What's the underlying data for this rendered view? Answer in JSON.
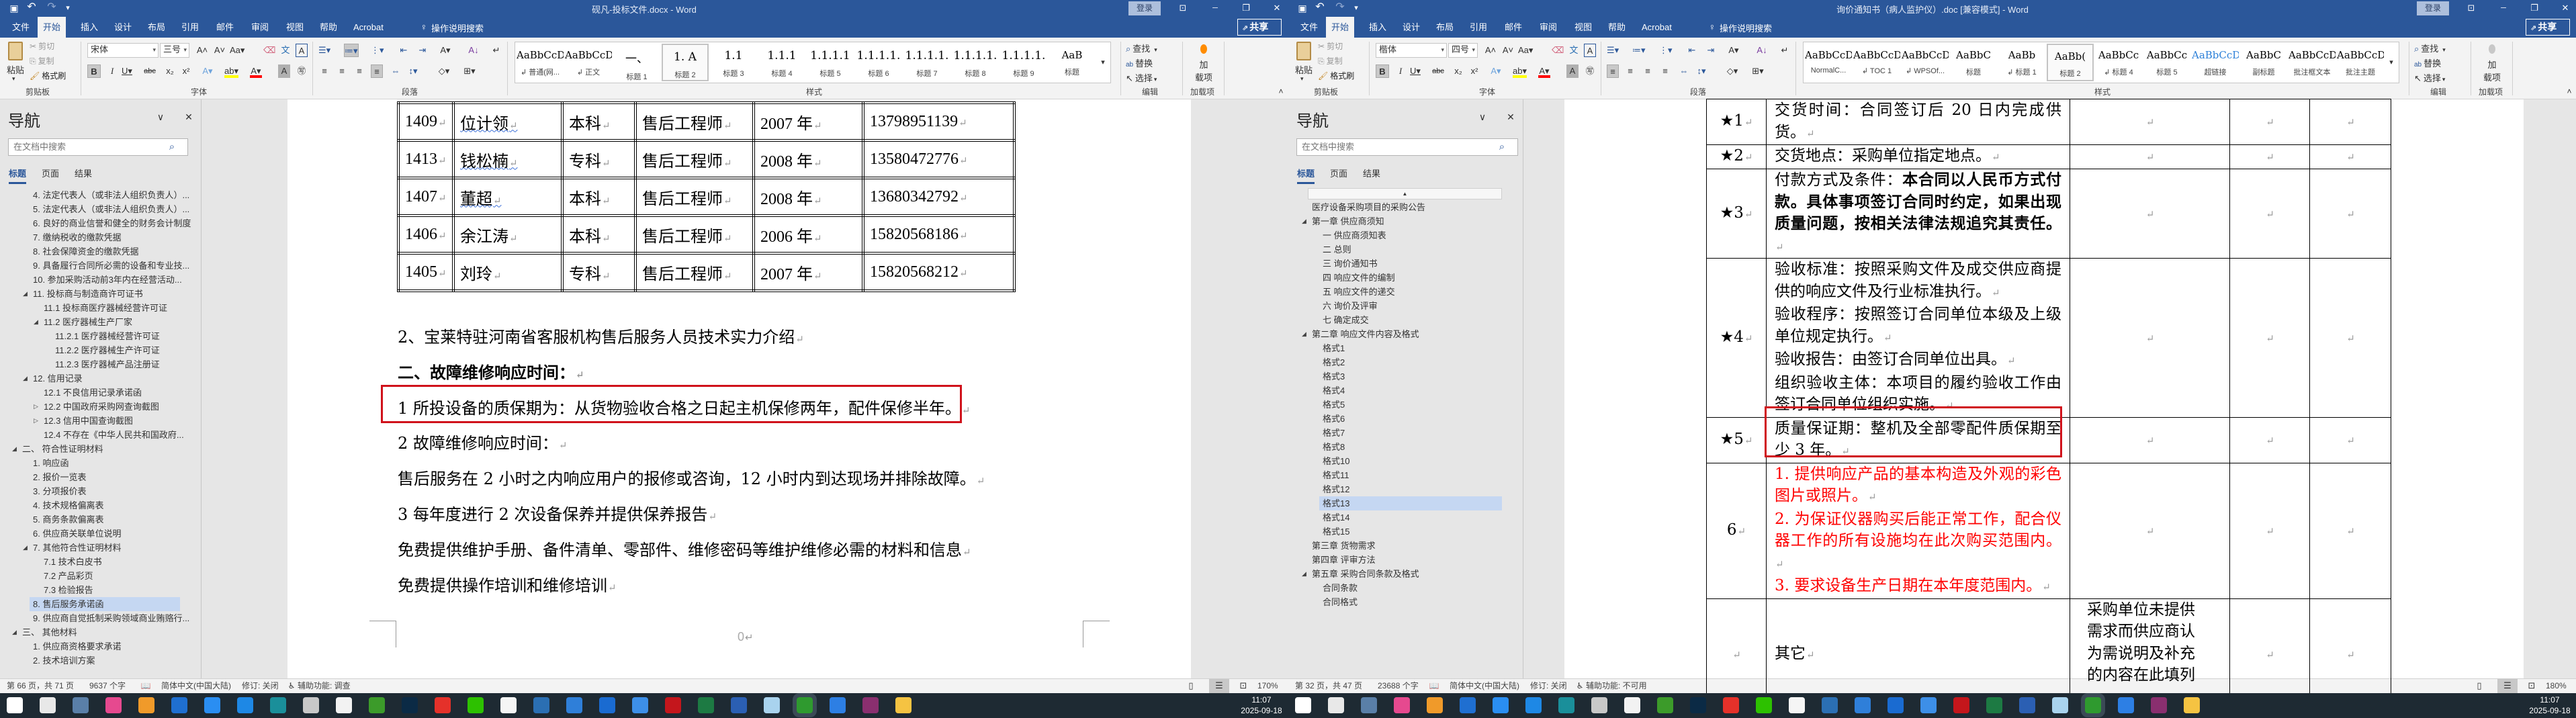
{
  "windows": [
    {
      "title": "砚凡-投标文件.docx - Word",
      "sign_in": "登录",
      "share": "共享",
      "tabs": [
        "文件",
        "开始",
        "插入",
        "设计",
        "布局",
        "引用",
        "邮件",
        "审阅",
        "视图",
        "帮助",
        "Acrobat"
      ],
      "active_tab": 1,
      "tell_me": "操作说明搜索",
      "ribbon": {
        "clipboard": {
          "paste": "粘贴",
          "cut": "剪切",
          "copy": "复制",
          "format_painter": "格式刷",
          "label": "剪贴板"
        },
        "font": {
          "name": "宋体",
          "size": "三号",
          "label": "字体"
        },
        "paragraph": {
          "label": "段落"
        },
        "styles": {
          "label": "样式",
          "selected": 3,
          "items": [
            {
              "preview": "AaBbCcDc",
              "name": "↲ 普通(网..."
            },
            {
              "preview": "AaBbCcDi",
              "name": "↲ 正文"
            },
            {
              "preview": "一、",
              "name": "标题 1"
            },
            {
              "preview": "1.  A",
              "name": "标题 2"
            },
            {
              "preview": "1.1",
              "name": "标题 3"
            },
            {
              "preview": "1.1.1",
              "name": "标题 4"
            },
            {
              "preview": "1.1.1.1",
              "name": "标题 5"
            },
            {
              "preview": "1.1.1.1.",
              "name": "标题 6"
            },
            {
              "preview": "1.1.1.1.",
              "name": "标题 7"
            },
            {
              "preview": "1.1.1.1.",
              "name": "标题 8"
            },
            {
              "preview": "1.1.1.1.",
              "name": "标题 9"
            },
            {
              "preview": "AaB",
              "name": "标题"
            }
          ]
        },
        "editing": {
          "find": "查找",
          "replace": "替换",
          "select": "选择",
          "label": "编辑"
        },
        "addins": {
          "button_line1": "加",
          "button_line2": "载项",
          "label": "加载项"
        }
      },
      "nav": {
        "title": "导航",
        "search_placeholder": "在文档中搜索",
        "tabs": [
          "标题",
          "页面",
          "结果"
        ],
        "items": [
          {
            "text": "4. 法定代表人（或非法人组织负责人）...",
            "level": 1,
            "toggle": "none"
          },
          {
            "text": "5. 法定代表人（或非法人组织负责人）...",
            "level": 1,
            "toggle": "none"
          },
          {
            "text": "6. 良好的商业信誉和健全的财务会计制度",
            "level": 1,
            "toggle": "none"
          },
          {
            "text": "7. 缴纳税收的缴款凭据",
            "level": 1,
            "toggle": "none"
          },
          {
            "text": "8. 社会保障资金的缴款凭据",
            "level": 1,
            "toggle": "none"
          },
          {
            "text": "9. 具备履行合同所必需的设备和专业技...",
            "level": 1,
            "toggle": "none"
          },
          {
            "text": "10. 参加采购活动前3年内在经营活动...",
            "level": 1,
            "toggle": "none"
          },
          {
            "text": "11. 投标商与制造商许可证书",
            "level": 1,
            "toggle": "expanded"
          },
          {
            "text": "11.1 投标商医疗器械经营许可证",
            "level": 2,
            "toggle": "none"
          },
          {
            "text": "11.2 医疗器械生产厂家",
            "level": 2,
            "toggle": "expanded"
          },
          {
            "text": "11.2.1 医疗器械经营许可证",
            "level": 3,
            "toggle": "none"
          },
          {
            "text": "11.2.2 医疗器械生产许可证",
            "level": 3,
            "toggle": "none"
          },
          {
            "text": "11.2.3 医疗器械产品注册证",
            "level": 3,
            "toggle": "none"
          },
          {
            "text": "12. 信用记录",
            "level": 1,
            "toggle": "expanded"
          },
          {
            "text": "12.1 不良信用记录承诺函",
            "level": 2,
            "toggle": "none"
          },
          {
            "text": "12.2 中国政府采购网查询截图",
            "level": 2,
            "toggle": "collapsed"
          },
          {
            "text": "12.3 信用中国查询截图",
            "level": 2,
            "toggle": "collapsed"
          },
          {
            "text": "12.4 不存在《中华人民共和国政府...",
            "level": 2,
            "toggle": "none"
          },
          {
            "text": "二、  符合性证明材料",
            "level": 0,
            "toggle": "expanded"
          },
          {
            "text": "1. 响应函",
            "level": 1,
            "toggle": "none"
          },
          {
            "text": "2. 报价一览表",
            "level": 1,
            "toggle": "none"
          },
          {
            "text": "3. 分项报价表",
            "level": 1,
            "toggle": "none"
          },
          {
            "text": "4. 技术规格偏离表",
            "level": 1,
            "toggle": "none"
          },
          {
            "text": "5. 商务条款偏离表",
            "level": 1,
            "toggle": "none"
          },
          {
            "text": "6. 供应商关联单位说明",
            "level": 1,
            "toggle": "none"
          },
          {
            "text": "7. 其他符合性证明材料",
            "level": 1,
            "toggle": "expanded"
          },
          {
            "text": "7.1 技术白皮书",
            "level": 2,
            "toggle": "none"
          },
          {
            "text": "7.2 产品彩页",
            "level": 2,
            "toggle": "none"
          },
          {
            "text": "7.3 检验报告",
            "level": 2,
            "toggle": "none"
          },
          {
            "text": "8. 售后服务承诺函",
            "level": 1,
            "toggle": "none",
            "selected": true
          },
          {
            "text": "9. 供应商自觉抵制采购领域商业贿赂行...",
            "level": 1,
            "toggle": "none"
          },
          {
            "text": "三、  其他材料",
            "level": 0,
            "toggle": "expanded"
          },
          {
            "text": "1. 供应商资格要求承诺",
            "level": 1,
            "toggle": "none"
          },
          {
            "text": "2. 技术培训方案",
            "level": 1,
            "toggle": "none"
          }
        ]
      },
      "status": {
        "page": "第 66 页，共 71 页",
        "words": "9637 个字",
        "language": "简体中文(中国大陆)",
        "track_changes": "修订: 关闭",
        "accessibility": "辅助功能: 调查",
        "zoom": "170%"
      }
    },
    {
      "title": "询价通知书（病人监护仪）.doc [兼容模式] - Word",
      "sign_in": "登录",
      "share": "共享",
      "tabs": [
        "文件",
        "开始",
        "插入",
        "设计",
        "布局",
        "引用",
        "邮件",
        "审阅",
        "视图",
        "帮助",
        "Acrobat"
      ],
      "active_tab": 1,
      "tell_me": "操作说明搜索",
      "ribbon": {
        "clipboard": {
          "paste": "粘贴",
          "cut": "剪切",
          "copy": "复制",
          "format_painter": "格式刷",
          "label": "剪贴板"
        },
        "font": {
          "name": "楷体",
          "size": "四号",
          "label": "字体"
        },
        "paragraph": {
          "label": "段落"
        },
        "styles": {
          "label": "样式",
          "selected": 5,
          "items": [
            {
              "preview": "AaBbCcDd",
              "name": "NormalC..."
            },
            {
              "preview": "AaBbCcDd",
              "name": "↲ TOC 1"
            },
            {
              "preview": "AaBbCcDdE",
              "name": "↲ WPSOf..."
            },
            {
              "preview": "AaBbC",
              "name": "标题"
            },
            {
              "preview": "AaBb",
              "name": "↲ 标题 1"
            },
            {
              "preview": "AaBb(",
              "name": "标题 2"
            },
            {
              "preview": "AaBbCc",
              "name": "↲ 标题 4"
            },
            {
              "preview": "AaBbCc",
              "name": "标题 5"
            },
            {
              "preview": "AaBbCcDd",
              "name": "超链接"
            },
            {
              "preview": "AaBbC",
              "name": "副标题"
            },
            {
              "preview": "AaBbCcDdE",
              "name": "批注框文本"
            },
            {
              "preview": "AaBbCcDd",
              "name": "批注主题"
            }
          ]
        },
        "editing": {
          "find": "查找",
          "replace": "替换",
          "select": "选择",
          "label": "编辑"
        },
        "addins": {
          "button_line1": "加",
          "button_line2": "载项",
          "label": "加载项"
        }
      },
      "nav": {
        "title": "导航",
        "search_placeholder": "在文档中搜索",
        "tabs": [
          "标题",
          "页面",
          "结果"
        ],
        "items": [
          {
            "text": "医疗设备采购项目的采购公告",
            "level": 0,
            "toggle": "none"
          },
          {
            "text": "第一章 供应商须知",
            "level": 0,
            "toggle": "expanded"
          },
          {
            "text": "一 供应商须知表",
            "level": 1,
            "toggle": "none"
          },
          {
            "text": "二 总则",
            "level": 1,
            "toggle": "none"
          },
          {
            "text": "三 询价通知书",
            "level": 1,
            "toggle": "none"
          },
          {
            "text": "四 响应文件的编制",
            "level": 1,
            "toggle": "none"
          },
          {
            "text": "五 响应文件的递交",
            "level": 1,
            "toggle": "none"
          },
          {
            "text": "六 询价及评审",
            "level": 1,
            "toggle": "none"
          },
          {
            "text": "七 确定成交",
            "level": 1,
            "toggle": "none"
          },
          {
            "text": "第二章 响应文件内容及格式",
            "level": 0,
            "toggle": "expanded"
          },
          {
            "text": "格式1",
            "level": 1,
            "toggle": "none"
          },
          {
            "text": "格式2",
            "level": 1,
            "toggle": "none"
          },
          {
            "text": "格式3",
            "level": 1,
            "toggle": "none"
          },
          {
            "text": "格式4",
            "level": 1,
            "toggle": "none"
          },
          {
            "text": "格式5",
            "level": 1,
            "toggle": "none"
          },
          {
            "text": "格式6",
            "level": 1,
            "toggle": "none"
          },
          {
            "text": "格式7",
            "level": 1,
            "toggle": "none"
          },
          {
            "text": "格式8",
            "level": 1,
            "toggle": "none"
          },
          {
            "text": "格式10",
            "level": 1,
            "toggle": "none"
          },
          {
            "text": "格式11",
            "level": 1,
            "toggle": "none"
          },
          {
            "text": "格式12",
            "level": 1,
            "toggle": "none"
          },
          {
            "text": "格式13",
            "level": 1,
            "toggle": "none",
            "selected": true
          },
          {
            "text": "格式14",
            "level": 1,
            "toggle": "none"
          },
          {
            "text": "格式15",
            "level": 1,
            "toggle": "none"
          },
          {
            "text": "第三章 货物需求",
            "level": 0,
            "toggle": "none"
          },
          {
            "text": "第四章 评审方法",
            "level": 0,
            "toggle": "none"
          },
          {
            "text": "第五章 采购合同条款及格式",
            "level": 0,
            "toggle": "expanded"
          },
          {
            "text": "合同条款",
            "level": 1,
            "toggle": "none"
          },
          {
            "text": "合同格式",
            "level": 1,
            "toggle": "none"
          }
        ]
      },
      "status": {
        "page": "第 32 页，共 47 页",
        "words": "23688 个字",
        "language": "简体中文(中国大陆)",
        "track_changes": "修订: 关闭",
        "accessibility": "辅助功能: 不可用",
        "zoom": "180%"
      }
    }
  ],
  "doc_left": {
    "staff_table": [
      [
        "1409",
        "位计领",
        "本科",
        "售后工程师",
        "2007 年",
        "13798951139"
      ],
      [
        "1413",
        "钱松楠",
        "专科",
        "售后工程师",
        "2008 年",
        "13580472776"
      ],
      [
        "1407",
        "董超",
        "本科",
        "售后工程师",
        "2008 年",
        "13680342792"
      ],
      [
        "1406",
        "余江涛",
        "本科",
        "售后工程师",
        "2006 年",
        "15820568186"
      ],
      [
        "1405",
        "刘玲",
        "专科",
        "售后工程师",
        "2007 年",
        "15820568212"
      ]
    ],
    "paragraphs": [
      "2、宝莱特驻河南省客服机构售后服务人员技术实力介绍",
      "二、故障维修响应时间：",
      "1 所投设备的质保期为：从货物验收合格之日起主机保修两年，配件保修半年。",
      "2 故障维修响应时间：",
      "售后服务在 2 小时之内响应用户的报修或咨询，12 小时内到达现场并排除故障。",
      "3 每年度进行 2 次设备保养并提供保养报告",
      "免费提供维护手册、备件清单、零部件、维修密码等维护维修必需的材料和信息",
      "免费提供操作培训和维修培训"
    ],
    "highlighted_paragraph": 2,
    "footer_mark": "0"
  },
  "doc_right": {
    "rows": [
      {
        "no": "★1",
        "lines": [
          "交货时间：合同签订后 20 日内完成供货。"
        ]
      },
      {
        "no": "★2",
        "lines": [
          "交货地点：采购单位指定地点。"
        ]
      },
      {
        "no": "★3",
        "label": "付款方式及条件：",
        "bold": "本合同以人民币方式付款。具体事项签订合同时约定，如果出现质量问题，按相关法律法规追究其责任。"
      },
      {
        "no": "★4",
        "lines": [
          "验收标准：按照采购文件及成交供应商提供的响应文件及行业标准执行。",
          "验收程序：按照签订合同单位本级及上级单位规定执行。",
          "验收报告：由签订合同单位出具。",
          "组织验收主体：本项目的履约验收工作由签订合同单位组织实施。"
        ]
      },
      {
        "no": "★5",
        "lines": [
          "质量保证期：整机及全部零配件质保期至少 3 年。"
        ],
        "highlighted": true
      },
      {
        "no": "6",
        "red": true,
        "lines": [
          "1. 提供响应产品的基本构造及外观的彩色图片或照片。",
          "2. 为保证仪器购买后能正常工作，配合仪器工作的所有设施均在此次购买范围内。",
          "3. 要求设备生产日期在本年度范围内。"
        ]
      },
      {
        "no": "",
        "lines": [
          "其它"
        ],
        "note": "采购单位未提供需求而供应商认为需说明及补充的内容在此填列"
      }
    ],
    "red_color": "#ff0000"
  },
  "taskbar": {
    "clock_time": "11:07",
    "clock_date": "2025-09-18",
    "apps": [
      {
        "name": "start",
        "color": "#ffffff"
      },
      {
        "name": "search",
        "color": "#e8e8e8"
      },
      {
        "name": "calculator",
        "color": "#5a7fa8"
      },
      {
        "name": "color-app",
        "color": "#e6498f"
      },
      {
        "name": "camera-app",
        "color": "#f09a2a"
      },
      {
        "name": "dots-app",
        "color": "#1f6fd1"
      },
      {
        "name": "todesk",
        "color": "#2a8ef2"
      },
      {
        "name": "circle-app",
        "color": "#1e88e5"
      },
      {
        "name": "sync-app",
        "color": "#1a8f9a"
      },
      {
        "name": "printer-app",
        "color": "#c8c8c8"
      },
      {
        "name": "blank-document",
        "color": "#f2f2f2"
      },
      {
        "name": "pen-app",
        "color": "#3c9b2a"
      },
      {
        "name": "photoshop",
        "color": "#0b2a45"
      },
      {
        "name": "petrochina",
        "color": "#e5312a"
      },
      {
        "name": "wechat",
        "color": "#2dc100"
      },
      {
        "name": "qq",
        "color": "#f5f5f5"
      },
      {
        "name": "xin-app",
        "color": "#2b6fb3"
      },
      {
        "name": "browser-a",
        "color": "#2f7fd9"
      },
      {
        "name": "browser-360",
        "color": "#1a6bd1"
      },
      {
        "name": "browser-b",
        "color": "#3d8fe8"
      },
      {
        "name": "acrobat",
        "color": "#c4161c"
      },
      {
        "name": "excel",
        "color": "#1d7a43"
      },
      {
        "name": "word",
        "color": "#2b5fb3"
      },
      {
        "name": "notepad",
        "color": "#a9d3ee"
      },
      {
        "name": "green-app",
        "color": "#2f9a2f",
        "active": true
      },
      {
        "name": "upload-app",
        "color": "#2d7fe4"
      },
      {
        "name": "winrar",
        "color": "#8a2f6f"
      },
      {
        "name": "file-explorer",
        "color": "#f5c342"
      }
    ]
  }
}
